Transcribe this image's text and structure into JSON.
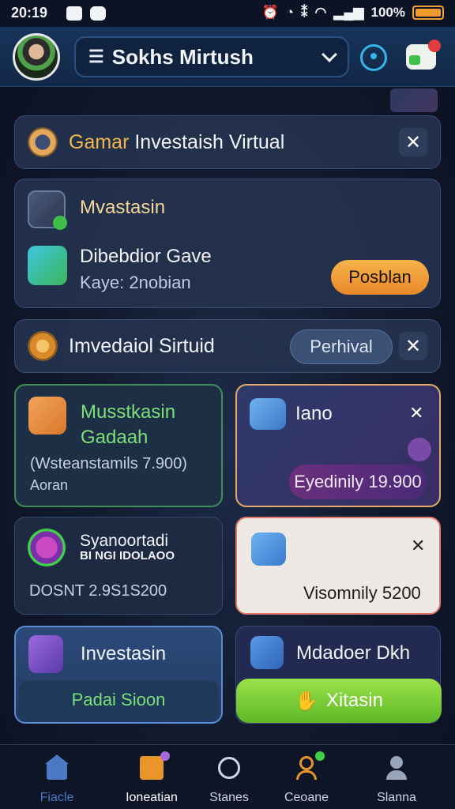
{
  "status_bar": {
    "time": "20:19",
    "battery": "100%"
  },
  "header": {
    "account_name": "Sokhs Mirtush"
  },
  "banner1": {
    "text_accent": "Gamar",
    "text_rest": " Investaish Virtual"
  },
  "mv_card": {
    "title": "Mvastasin",
    "item_title": "Dibebdior Gave",
    "item_sub": "Kaye: 2nobian",
    "button": "Posblan"
  },
  "banner2": {
    "text": "Imvedaiol Sirtuid",
    "button": "Perhival"
  },
  "tiles": {
    "t1": {
      "title_line1": "Musstkasin",
      "title_line2": "Gadaah",
      "sub1": "(Wsteanstamils 7.900)",
      "sub2": "Aoran"
    },
    "t2": {
      "title": "Iano",
      "button": "Eyedinily 19.900"
    },
    "t3": {
      "title_line1": "Syanoortadi",
      "title_line2": "BI NGI  IDOLAOO",
      "sub": "DOSNT 2.9S1S200"
    },
    "t4": {
      "value": "Visomnily 5200"
    },
    "t5": {
      "title": "Investasin",
      "button": "Padai Sioon"
    },
    "t6": {
      "title": "Mdadoer Dkh",
      "button": "Xitasin"
    }
  },
  "nav": {
    "items": [
      {
        "label": "Fiacle"
      },
      {
        "label": "Ioneatian"
      },
      {
        "label": "Stanes"
      },
      {
        "label": "Ceoane"
      },
      {
        "label": "Slanna"
      }
    ]
  },
  "colors": {
    "accent_orange": "#f4b64a",
    "accent_green": "#6fdc6a",
    "nav_active": "#4a78c2"
  }
}
